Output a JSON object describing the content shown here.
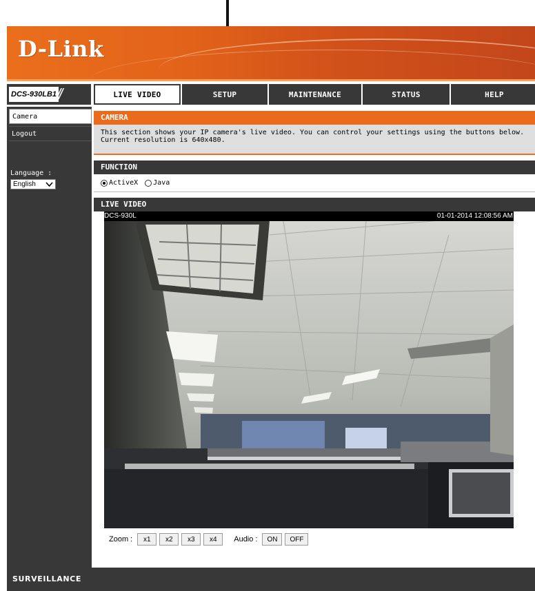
{
  "brand": {
    "logo_text": "D-Link",
    "accent": "#ea6b1b",
    "dark": "#383838"
  },
  "nav": {
    "model": "DCS-930LB1",
    "tabs": [
      {
        "label": "LIVE VIDEO",
        "active": true
      },
      {
        "label": "SETUP"
      },
      {
        "label": "MAINTENANCE"
      },
      {
        "label": "STATUS"
      },
      {
        "label": "HELP"
      }
    ]
  },
  "sidebar": {
    "items": [
      {
        "label": "Camera",
        "active": true
      },
      {
        "label": "Logout"
      }
    ],
    "language_label": "Language :",
    "language_value": "English"
  },
  "camera": {
    "title": "CAMERA",
    "line1": "This section shows your IP camera's live video. You can control your settings using the buttons below.",
    "line2": "Current resolution is 640x480."
  },
  "function": {
    "title": "FUNCTION",
    "options": [
      {
        "label": "ActiveX",
        "selected": true
      },
      {
        "label": "Java",
        "selected": false
      }
    ]
  },
  "live_video": {
    "title": "LIVE VIDEO",
    "camera_name": "DCS-930L",
    "timestamp": "01-01-2014 12:08:56 AM"
  },
  "controls": {
    "zoom_label": "Zoom :",
    "zoom_buttons": [
      "x1",
      "x2",
      "x3",
      "x4"
    ],
    "audio_label": "Audio :",
    "audio_buttons": [
      "ON",
      "OFF"
    ]
  },
  "footer": {
    "brand": "SURVEILLANCE"
  }
}
